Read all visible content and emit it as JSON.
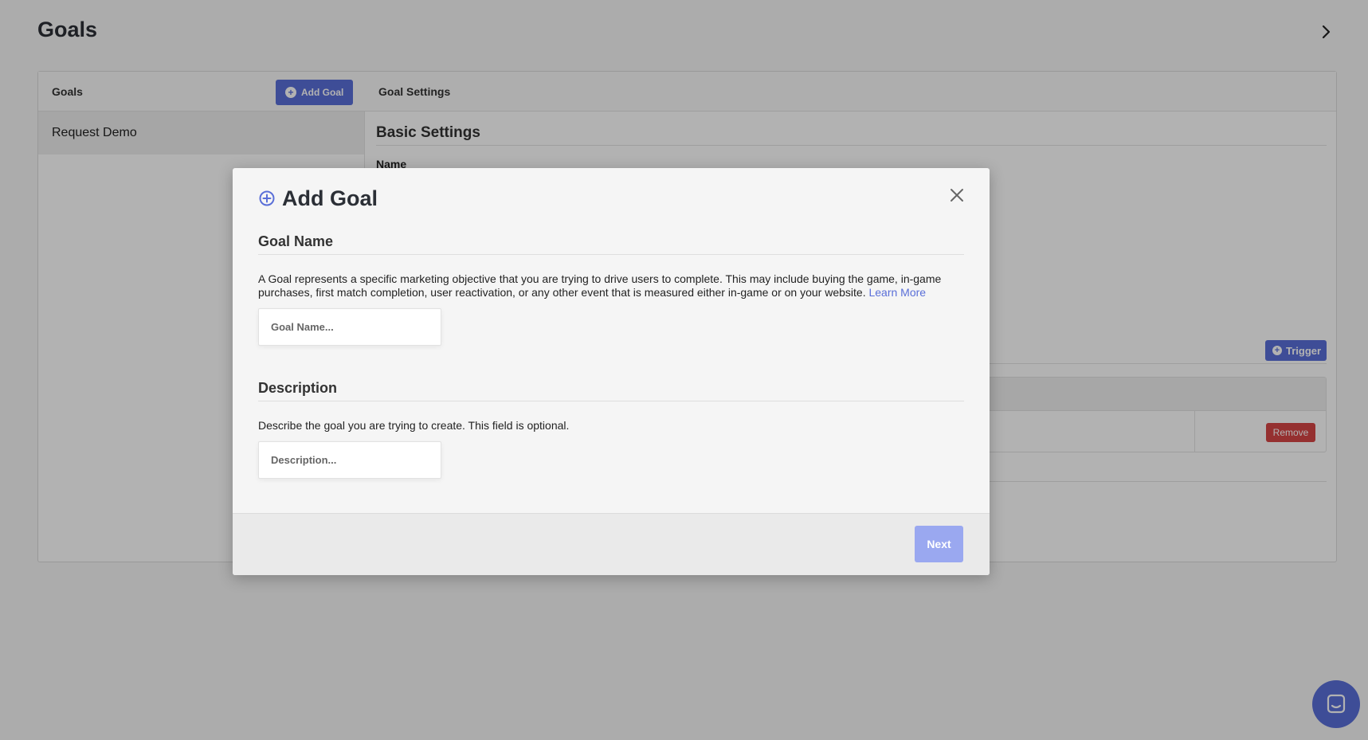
{
  "page": {
    "title": "Goals"
  },
  "panel": {
    "goals_heading": "Goals",
    "add_goal_label": "Add Goal",
    "goal_settings_heading": "Goal Settings",
    "goal_items": [
      {
        "label": "Request Demo"
      }
    ],
    "basic_settings_title": "Basic Settings",
    "name_label": "Name",
    "trigger_label": "Trigger",
    "remove_label": "Remove"
  },
  "modal": {
    "title": "Add Goal",
    "goal_name": {
      "title": "Goal Name",
      "description": "A Goal represents a specific marketing objective that you are trying to drive users to complete. This may include buying the game, in-game purchases, first match completion, user reactivation, or any other event that is measured either in-game or on your website.",
      "learn_more": "Learn More",
      "placeholder": "Goal Name...",
      "value": ""
    },
    "description": {
      "title": "Description",
      "text": "Describe the goal you are trying to create. This field is optional.",
      "placeholder": "Description...",
      "value": ""
    },
    "next_label": "Next"
  },
  "colors": {
    "primary": "#5a6fd8",
    "primary_disabled": "#9aa8f0",
    "danger": "#d64545"
  },
  "icons": {
    "collapse": "chevron-right-icon",
    "add": "plus-circle-icon",
    "close": "close-icon",
    "chat": "chat-icon"
  }
}
